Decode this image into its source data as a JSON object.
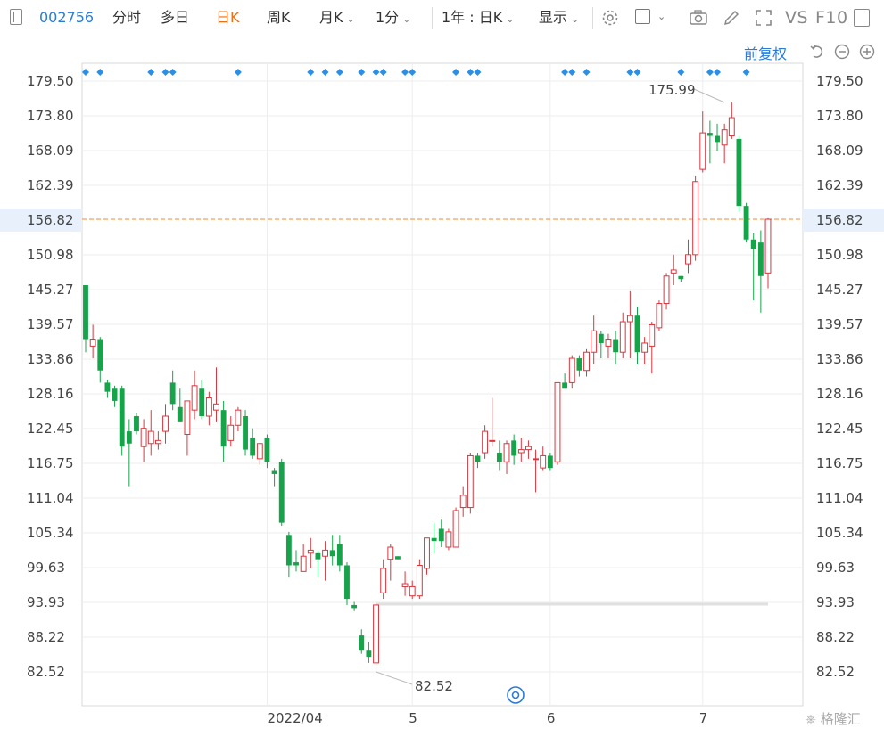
{
  "toolbar": {
    "stock_code": "002756",
    "tab_fenshi": "分时",
    "tab_duori": "多日",
    "tab_rik": "日K",
    "tab_zhouk": "周K",
    "tab_yuek": "月K",
    "tab_1fen": "1分",
    "range_select": "1年 : 日K",
    "display_select": "显示",
    "vs_label": "VS",
    "f10_label": "F10"
  },
  "chart_header": {
    "adjust_label": "前复权"
  },
  "watermark": "格隆汇",
  "colors": {
    "up": "#d9363e",
    "down": "#16a34a",
    "accent_blue": "#2b7bd6",
    "current_price_line": "#f08a3c",
    "current_price_label": "#e03a3a",
    "current_price_bg": "#e8f1fb",
    "marker": "#2b8fe6"
  },
  "chart_data": {
    "type": "candlestick",
    "y_ticks": [
      "179.50",
      "173.80",
      "168.09",
      "162.39",
      "156.82",
      "150.98",
      "145.27",
      "139.57",
      "133.86",
      "128.16",
      "122.45",
      "116.75",
      "111.04",
      "105.34",
      "99.63",
      "93.93",
      "88.22",
      "82.52"
    ],
    "y_range": [
      82.52,
      179.5
    ],
    "x_labels": [
      {
        "label": "2022/04",
        "index": 25
      },
      {
        "label": "5",
        "index": 45
      },
      {
        "label": "6",
        "index": 64
      },
      {
        "label": "7",
        "index": 85
      }
    ],
    "current_price": 156.82,
    "max_annotation": {
      "value": "175.99",
      "index": 88
    },
    "min_annotation": {
      "value": "82.52",
      "index": 40
    },
    "marker_indices": [
      0,
      2,
      9,
      11,
      12,
      21,
      31,
      33,
      35,
      38,
      40,
      41,
      44,
      45,
      51,
      53,
      54,
      66,
      67,
      69,
      75,
      76,
      82,
      86,
      87,
      91
    ],
    "candles": [
      {
        "o": 146.0,
        "h": 146.0,
        "l": 135.0,
        "c": 137.0
      },
      {
        "o": 136.0,
        "h": 139.5,
        "l": 134.0,
        "c": 137.0
      },
      {
        "o": 137.0,
        "h": 137.5,
        "l": 130.0,
        "c": 132.0
      },
      {
        "o": 130.0,
        "h": 130.5,
        "l": 127.5,
        "c": 128.5
      },
      {
        "o": 129.0,
        "h": 129.5,
        "l": 126.0,
        "c": 127.0
      },
      {
        "o": 129.0,
        "h": 129.5,
        "l": 118.0,
        "c": 119.5
      },
      {
        "o": 122.0,
        "h": 124.0,
        "l": 113.0,
        "c": 120.0
      },
      {
        "o": 124.5,
        "h": 125.0,
        "l": 121.5,
        "c": 122.0
      },
      {
        "o": 119.5,
        "h": 124.0,
        "l": 117.0,
        "c": 122.5
      },
      {
        "o": 120.0,
        "h": 125.5,
        "l": 118.0,
        "c": 122.0
      },
      {
        "o": 120.0,
        "h": 122.0,
        "l": 119.0,
        "c": 120.5
      },
      {
        "o": 122.0,
        "h": 126.5,
        "l": 120.0,
        "c": 124.5
      },
      {
        "o": 130.0,
        "h": 132.0,
        "l": 125.5,
        "c": 126.5
      },
      {
        "o": 126.0,
        "h": 129.0,
        "l": 123.5,
        "c": 123.5
      },
      {
        "o": 121.5,
        "h": 127.0,
        "l": 118.0,
        "c": 127.0
      },
      {
        "o": 125.5,
        "h": 132.0,
        "l": 124.0,
        "c": 129.5
      },
      {
        "o": 129.0,
        "h": 130.5,
        "l": 124.0,
        "c": 124.5
      },
      {
        "o": 124.5,
        "h": 128.5,
        "l": 123.0,
        "c": 127.5
      },
      {
        "o": 125.5,
        "h": 132.5,
        "l": 123.5,
        "c": 126.5
      },
      {
        "o": 125.5,
        "h": 127.0,
        "l": 117.0,
        "c": 119.5
      },
      {
        "o": 120.5,
        "h": 124.5,
        "l": 119.5,
        "c": 123.0
      },
      {
        "o": 123.0,
        "h": 126.0,
        "l": 122.0,
        "c": 125.5
      },
      {
        "o": 124.5,
        "h": 125.5,
        "l": 118.0,
        "c": 119.0
      },
      {
        "o": 121.0,
        "h": 122.5,
        "l": 117.5,
        "c": 118.0
      },
      {
        "o": 117.5,
        "h": 120.0,
        "l": 116.5,
        "c": 120.0
      },
      {
        "o": 121.0,
        "h": 121.5,
        "l": 116.0,
        "c": 117.0
      },
      {
        "o": 115.5,
        "h": 116.0,
        "l": 113.0,
        "c": 115.0
      },
      {
        "o": 117.0,
        "h": 117.5,
        "l": 106.5,
        "c": 107.0
      },
      {
        "o": 105.0,
        "h": 105.5,
        "l": 98.0,
        "c": 100.0
      },
      {
        "o": 100.5,
        "h": 102.5,
        "l": 99.0,
        "c": 100.0
      },
      {
        "o": 99.0,
        "h": 103.5,
        "l": 99.0,
        "c": 101.5
      },
      {
        "o": 102.0,
        "h": 104.5,
        "l": 99.5,
        "c": 102.5
      },
      {
        "o": 102.0,
        "h": 102.5,
        "l": 98.0,
        "c": 101.0
      },
      {
        "o": 101.5,
        "h": 104.0,
        "l": 97.5,
        "c": 102.5
      },
      {
        "o": 102.5,
        "h": 105.0,
        "l": 100.0,
        "c": 101.5
      },
      {
        "o": 103.5,
        "h": 105.0,
        "l": 99.0,
        "c": 100.0
      },
      {
        "o": 100.0,
        "h": 100.5,
        "l": 93.5,
        "c": 94.5
      },
      {
        "o": 93.5,
        "h": 94.0,
        "l": 92.5,
        "c": 93.0
      },
      {
        "o": 88.5,
        "h": 89.5,
        "l": 85.5,
        "c": 86.0
      },
      {
        "o": 86.0,
        "h": 87.5,
        "l": 84.0,
        "c": 85.0
      },
      {
        "o": 84.0,
        "h": 93.5,
        "l": 82.52,
        "c": 93.5
      },
      {
        "o": 95.5,
        "h": 101.0,
        "l": 94.5,
        "c": 99.5
      },
      {
        "o": 101.0,
        "h": 103.5,
        "l": 97.5,
        "c": 103.0
      },
      {
        "o": 101.5,
        "h": 101.5,
        "l": 101.0,
        "c": 101.0
      },
      {
        "o": 96.5,
        "h": 99.0,
        "l": 95.0,
        "c": 97.0
      },
      {
        "o": 95.0,
        "h": 97.5,
        "l": 94.5,
        "c": 96.5
      },
      {
        "o": 95.0,
        "h": 101.0,
        "l": 94.5,
        "c": 100.0
      },
      {
        "o": 99.5,
        "h": 104.5,
        "l": 98.5,
        "c": 104.5
      },
      {
        "o": 104.5,
        "h": 107.0,
        "l": 102.0,
        "c": 104.0
      },
      {
        "o": 106.0,
        "h": 107.5,
        "l": 103.0,
        "c": 104.0
      },
      {
        "o": 103.0,
        "h": 106.0,
        "l": 102.5,
        "c": 105.5
      },
      {
        "o": 103.0,
        "h": 109.5,
        "l": 103.0,
        "c": 109.0
      },
      {
        "o": 109.5,
        "h": 113.0,
        "l": 108.0,
        "c": 111.5
      },
      {
        "o": 109.5,
        "h": 118.5,
        "l": 108.5,
        "c": 118.0
      },
      {
        "o": 118.0,
        "h": 118.5,
        "l": 116.0,
        "c": 117.0
      },
      {
        "o": 118.5,
        "h": 123.0,
        "l": 117.5,
        "c": 122.0
      },
      {
        "o": 120.5,
        "h": 127.5,
        "l": 119.5,
        "c": 120.5
      },
      {
        "o": 118.5,
        "h": 120.5,
        "l": 115.5,
        "c": 117.0
      },
      {
        "o": 117.0,
        "h": 120.5,
        "l": 115.0,
        "c": 120.0
      },
      {
        "o": 120.5,
        "h": 121.5,
        "l": 116.5,
        "c": 118.0
      },
      {
        "o": 118.5,
        "h": 121.0,
        "l": 117.0,
        "c": 119.0
      },
      {
        "o": 119.0,
        "h": 120.5,
        "l": 117.5,
        "c": 119.5
      },
      {
        "o": 117.5,
        "h": 119.0,
        "l": 112.0,
        "c": 117.5
      },
      {
        "o": 116.0,
        "h": 119.5,
        "l": 115.5,
        "c": 118.0
      },
      {
        "o": 118.0,
        "h": 118.5,
        "l": 115.5,
        "c": 116.0
      },
      {
        "o": 117.0,
        "h": 130.0,
        "l": 116.5,
        "c": 130.0
      },
      {
        "o": 130.0,
        "h": 131.5,
        "l": 129.0,
        "c": 129.0
      },
      {
        "o": 130.0,
        "h": 134.5,
        "l": 129.0,
        "c": 134.0
      },
      {
        "o": 134.0,
        "h": 134.5,
        "l": 131.0,
        "c": 132.0
      },
      {
        "o": 132.0,
        "h": 135.5,
        "l": 131.0,
        "c": 135.0
      },
      {
        "o": 135.0,
        "h": 141.0,
        "l": 133.0,
        "c": 138.5
      },
      {
        "o": 138.0,
        "h": 138.5,
        "l": 134.0,
        "c": 136.5
      },
      {
        "o": 136.0,
        "h": 138.0,
        "l": 134.0,
        "c": 137.0
      },
      {
        "o": 137.0,
        "h": 138.5,
        "l": 133.0,
        "c": 135.0
      },
      {
        "o": 135.0,
        "h": 141.5,
        "l": 134.0,
        "c": 140.0
      },
      {
        "o": 140.0,
        "h": 145.0,
        "l": 134.0,
        "c": 141.0
      },
      {
        "o": 141.0,
        "h": 142.5,
        "l": 133.0,
        "c": 135.0
      },
      {
        "o": 135.0,
        "h": 137.5,
        "l": 133.0,
        "c": 136.5
      },
      {
        "o": 136.0,
        "h": 140.0,
        "l": 131.5,
        "c": 139.5
      },
      {
        "o": 139.0,
        "h": 143.5,
        "l": 138.5,
        "c": 143.0
      },
      {
        "o": 143.0,
        "h": 148.0,
        "l": 142.0,
        "c": 147.5
      },
      {
        "o": 148.0,
        "h": 151.0,
        "l": 146.0,
        "c": 148.5
      },
      {
        "o": 147.5,
        "h": 147.5,
        "l": 146.5,
        "c": 147.0
      },
      {
        "o": 149.5,
        "h": 153.5,
        "l": 148.0,
        "c": 151.0
      },
      {
        "o": 151.0,
        "h": 164.0,
        "l": 150.0,
        "c": 163.0
      },
      {
        "o": 165.0,
        "h": 174.5,
        "l": 164.5,
        "c": 171.0
      },
      {
        "o": 171.0,
        "h": 173.0,
        "l": 166.0,
        "c": 170.5
      },
      {
        "o": 170.5,
        "h": 172.5,
        "l": 168.0,
        "c": 169.5
      },
      {
        "o": 169.0,
        "h": 172.5,
        "l": 166.0,
        "c": 171.5
      },
      {
        "o": 170.5,
        "h": 175.99,
        "l": 170.0,
        "c": 173.5
      },
      {
        "o": 170.0,
        "h": 170.5,
        "l": 158.0,
        "c": 159.0
      },
      {
        "o": 159.0,
        "h": 159.5,
        "l": 153.0,
        "c": 153.5
      },
      {
        "o": 153.5,
        "h": 154.5,
        "l": 143.5,
        "c": 152.0
      },
      {
        "o": 153.0,
        "h": 155.0,
        "l": 141.5,
        "c": 147.5
      },
      {
        "o": 148.0,
        "h": 157.0,
        "l": 145.5,
        "c": 156.82
      }
    ]
  }
}
